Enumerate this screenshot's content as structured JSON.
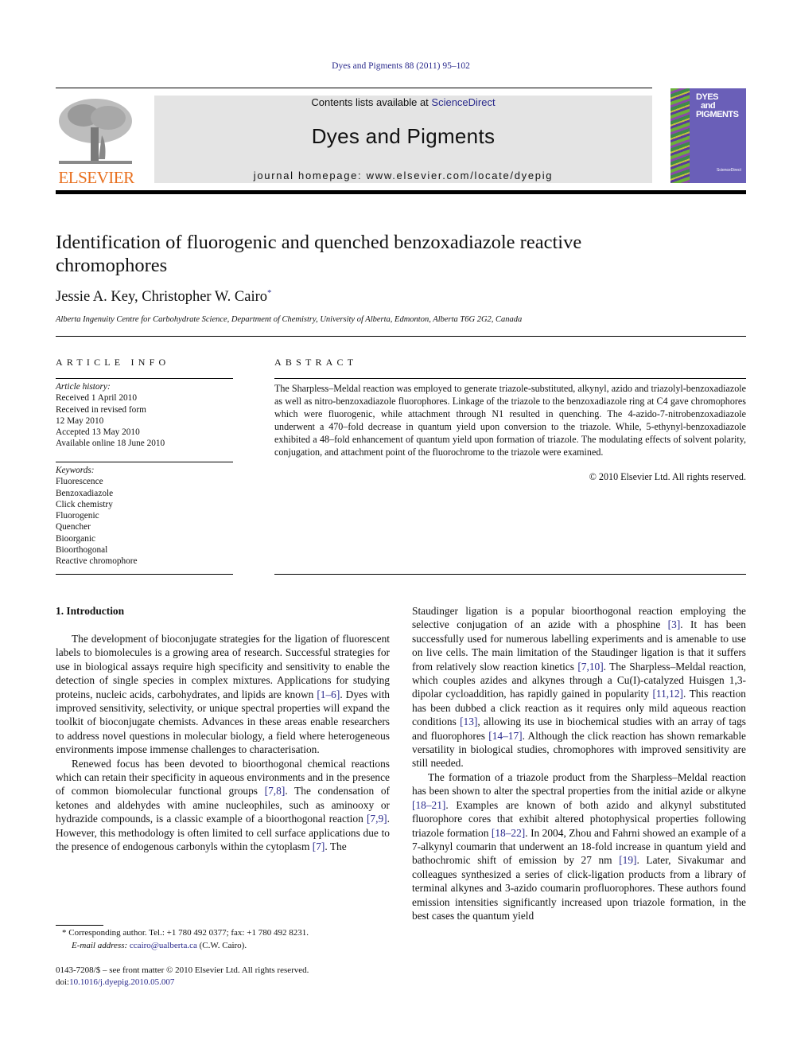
{
  "header": {
    "journal_reference": "Dyes and Pigments 88 (2011) 95–102",
    "contents_prefix": "Contents lists available at ",
    "contents_link": "ScienceDirect",
    "journal_title": "Dyes and Pigments",
    "homepage": "journal homepage: www.elsevier.com/locate/dyepig",
    "publisher_logo_text": "ELSEVIER",
    "cover_title_lines": [
      "DYES",
      "and",
      "PIGMENTS"
    ],
    "cover_footer": "ScienceDirect"
  },
  "colors": {
    "link": "#2a2a8c",
    "elsevier_orange": "#e8701f",
    "banner_gray": "#e4e4e4",
    "cover_purple": "#6a5fb8"
  },
  "article": {
    "title": "Identification of fluorogenic and quenched benzoxadiazole reactive chromophores",
    "authors": "Jessie A. Key, Christopher W. Cairo",
    "corresponding_marker": "*",
    "affiliation": "Alberta Ingenuity Centre for Carbohydrate Science, Department of Chemistry, University of Alberta, Edmonton, Alberta T6G 2G2, Canada"
  },
  "article_info": {
    "heading": "ARTICLE INFO",
    "history_label": "Article history:",
    "history": [
      "Received 1 April 2010",
      "Received in revised form",
      "12 May 2010",
      "Accepted 13 May 2010",
      "Available online 18 June 2010"
    ],
    "keywords_label": "Keywords:",
    "keywords": [
      "Fluorescence",
      "Benzoxadiazole",
      "Click chemistry",
      "Fluorogenic",
      "Quencher",
      "Bioorganic",
      "Bioorthogonal",
      "Reactive chromophore"
    ]
  },
  "abstract": {
    "heading": "ABSTRACT",
    "text": "The Sharpless–Meldal reaction was employed to generate triazole-substituted, alkynyl, azido and triazolyl-benzoxadiazole as well as nitro-benzoxadiazole fluorophores. Linkage of the triazole to the benzoxadiazole ring at C4 gave chromophores which were fluorogenic, while attachment through N1 resulted in quenching. The 4-azido-7-nitrobenzoxadiazole underwent a 470–fold decrease in quantum yield upon conversion to the triazole. While, 5-ethynyl-benzoxadiazole exhibited a 48–fold enhancement of quantum yield upon formation of triazole. The modulating effects of solvent polarity, conjugation, and attachment point of the fluorochrome to the triazole were examined.",
    "copyright": "© 2010 Elsevier Ltd. All rights reserved."
  },
  "introduction": {
    "heading": "1.  Introduction",
    "left_paragraphs": [
      {
        "segments": [
          {
            "t": "The development of bioconjugate strategies for the ligation of fluorescent labels to biomolecules is a growing area of research. Successful strategies for use in biological assays require high specificity and sensitivity to enable the detection of single species in complex mixtures. Applications for studying proteins, nucleic acids, carbohydrates, and lipids are known "
          },
          {
            "r": "[1–6]"
          },
          {
            "t": ". Dyes with improved sensitivity, selectivity, or unique spectral properties will expand the toolkit of bioconjugate chemists. Advances in these areas enable researchers to address novel questions in molecular biology, a field where heterogeneous environments impose immense challenges to characterisation."
          }
        ]
      },
      {
        "segments": [
          {
            "t": "Renewed focus has been devoted to bioorthogonal chemical reactions which can retain their specificity in aqueous environments and in the presence of common biomolecular functional groups "
          },
          {
            "r": "[7,8]"
          },
          {
            "t": ". The condensation of ketones and aldehydes with amine nucleophiles, such as aminooxy or hydrazide compounds, is a classic example of a bioorthogonal reaction "
          },
          {
            "r": "[7,9]"
          },
          {
            "t": ". However, this methodology is often limited to cell surface applications due to the presence of endogenous carbonyls within the cytoplasm "
          },
          {
            "r": "[7]"
          },
          {
            "t": ". The"
          }
        ]
      }
    ],
    "right_paragraphs": [
      {
        "noindent": true,
        "segments": [
          {
            "t": "Staudinger ligation is a popular bioorthogonal reaction employing the selective conjugation of an azide with a phosphine "
          },
          {
            "r": "[3]"
          },
          {
            "t": ". It has been successfully used for numerous labelling experiments and is amenable to use on live cells. The main limitation of the Staudinger ligation is that it suffers from relatively slow reaction kinetics "
          },
          {
            "r": "[7,10]"
          },
          {
            "t": ". The Sharpless–Meldal reaction, which couples azides and alkynes through a Cu(I)-catalyzed Huisgen 1,3-dipolar cycloaddition, has rapidly gained in popularity "
          },
          {
            "r": "[11,12]"
          },
          {
            "t": ". This reaction has been dubbed a click reaction as it requires only mild aqueous reaction conditions "
          },
          {
            "r": "[13]"
          },
          {
            "t": ", allowing its use in biochemical studies with an array of tags and fluorophores "
          },
          {
            "r": "[14–17]"
          },
          {
            "t": ". Although the click reaction has shown remarkable versatility in biological studies, chromophores with improved sensitivity are still needed."
          }
        ]
      },
      {
        "segments": [
          {
            "t": "The formation of a triazole product from the Sharpless–Meldal reaction has been shown to alter the spectral properties from the initial azide or alkyne "
          },
          {
            "r": "[18–21]"
          },
          {
            "t": ". Examples are known of both azido and alkynyl substituted fluorophore cores that exhibit altered photophysical properties following triazole formation "
          },
          {
            "r": "[18–22]"
          },
          {
            "t": ". In 2004, Zhou and Fahrni showed an example of a 7-alkynyl coumarin that underwent an 18-fold increase in quantum yield and bathochromic shift of emission by 27 nm "
          },
          {
            "r": "[19]"
          },
          {
            "t": ". Later, Sivakumar and colleagues synthesized a series of click-ligation products from a library of terminal alkynes and 3-azido coumarin profluorophores. These authors found emission intensities significantly increased upon triazole formation, in the best cases the quantum yield"
          }
        ]
      }
    ]
  },
  "footnotes": {
    "corresponding": "* Corresponding author. Tel.: +1 780 492 0377; fax: +1 780 492 8231.",
    "email_label": "E-mail address: ",
    "email": "ccairo@ualberta.ca",
    "email_suffix": " (C.W. Cairo).",
    "front_matter": "0143-7208/$ – see front matter © 2010 Elsevier Ltd. All rights reserved.",
    "doi_label": "doi:",
    "doi": "10.1016/j.dyepig.2010.05.007"
  }
}
